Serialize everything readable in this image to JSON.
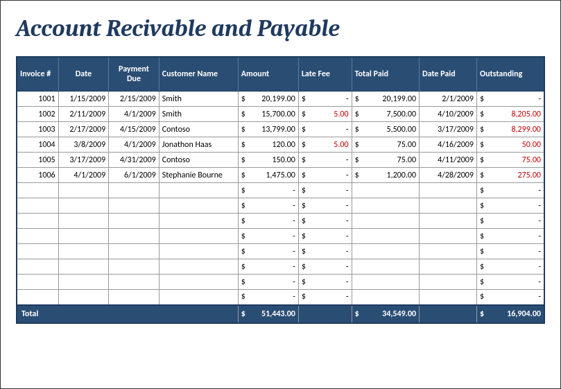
{
  "title": "Account Recivable and Payable",
  "headers": {
    "invoice": "Invoice #",
    "date": "Date",
    "payment_due": "Payment Due",
    "customer": "Customer Name",
    "amount": "Amount",
    "late_fee": "Late Fee",
    "total_paid": "Total Paid",
    "date_paid": "Date Paid",
    "outstanding": "Outstanding"
  },
  "currency_symbol": "$",
  "dash": "-",
  "rows": [
    {
      "invoice": "1001",
      "date": "1/15/2009",
      "payment_due": "2/15/2009",
      "customer": "Smith",
      "amount": "20,199.00",
      "late_fee": "-",
      "total_paid": "20,199.00",
      "date_paid": "2/1/2009",
      "outstanding": "-",
      "out_red": false
    },
    {
      "invoice": "1002",
      "date": "2/11/2009",
      "payment_due": "4/1/2009",
      "customer": "Smith",
      "amount": "15,700.00",
      "late_fee": "5.00",
      "late_red": true,
      "total_paid": "7,500.00",
      "date_paid": "4/10/2009",
      "outstanding": "8,205.00",
      "out_red": true
    },
    {
      "invoice": "1003",
      "date": "2/17/2009",
      "payment_due": "4/15/2009",
      "customer": "Contoso",
      "amount": "13,799.00",
      "late_fee": "-",
      "total_paid": "5,500.00",
      "date_paid": "3/17/2009",
      "outstanding": "8,299.00",
      "out_red": true
    },
    {
      "invoice": "1004",
      "date": "3/8/2009",
      "payment_due": "4/1/2009",
      "customer": "Jonathon Haas",
      "amount": "120.00",
      "late_fee": "5.00",
      "late_red": true,
      "total_paid": "75.00",
      "date_paid": "4/16/2009",
      "outstanding": "50.00",
      "out_red": true
    },
    {
      "invoice": "1005",
      "date": "3/17/2009",
      "payment_due": "4/31/2009",
      "customer": "Contoso",
      "amount": "150.00",
      "late_fee": "-",
      "total_paid": "75.00",
      "date_paid": "4/11/2009",
      "outstanding": "75.00",
      "out_red": true
    },
    {
      "invoice": "1006",
      "date": "4/1/2009",
      "payment_due": "6/1/2009",
      "customer": "Stephanie Bourne",
      "amount": "1,475.00",
      "late_fee": "-",
      "total_paid": "1,200.00",
      "date_paid": "4/28/2009",
      "outstanding": "275.00",
      "out_red": true
    }
  ],
  "empty_row_count": 8,
  "totals": {
    "label": "Total",
    "amount": "51,443.00",
    "total_paid": "34,549.00",
    "outstanding": "16,904.00"
  }
}
